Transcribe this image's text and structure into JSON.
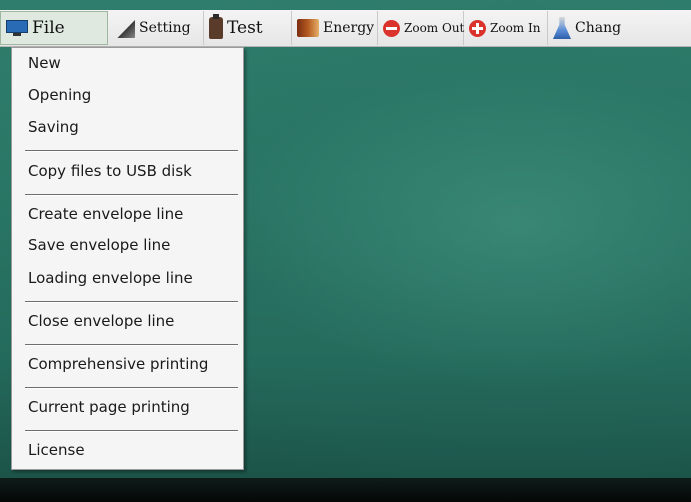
{
  "toolbar": {
    "file_label": "File",
    "setting_label": "Setting",
    "test_label": "Test",
    "energy_label": "Energy",
    "zoom_out_label": "Zoom Out",
    "zoom_in_label": "Zoom In",
    "change_label": "Chang"
  },
  "icons": {
    "file": "monitor-icon",
    "setting": "tools-icon",
    "test": "bottle-icon",
    "energy": "book-icon",
    "zoom_out": "minus-circle-icon",
    "zoom_in": "plus-circle-icon",
    "change": "flask-icon"
  },
  "file_menu": {
    "items": [
      "New",
      "Opening",
      "Saving",
      "Copy files to USB disk",
      "Create envelope line",
      "Save envelope line",
      "Loading envelope line",
      "Close envelope line",
      "Comprehensive printing",
      "Current page printing",
      "License"
    ]
  },
  "colors": {
    "screen_background": "#2a7766",
    "menu_background": "#f5f5f5",
    "toolbar_background": "#ececec",
    "zoom_icon_red": "#d9332b"
  }
}
